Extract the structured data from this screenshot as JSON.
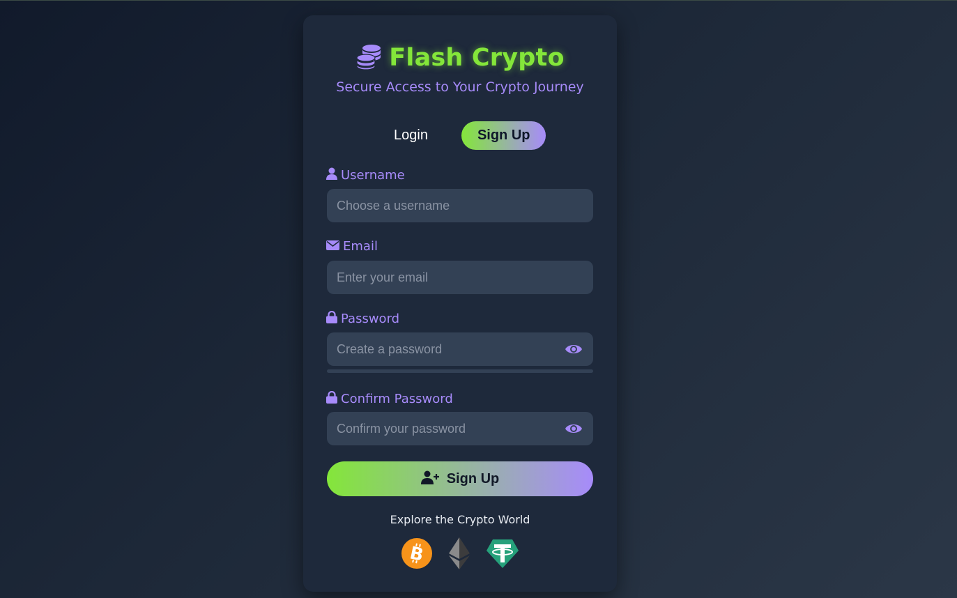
{
  "brand": {
    "title": "Flash Crypto",
    "subtitle": "Secure Access to Your Crypto Journey",
    "icon": "coins-icon"
  },
  "tabs": [
    {
      "label": "Login",
      "active": false
    },
    {
      "label": "Sign Up",
      "active": true
    }
  ],
  "form": {
    "username": {
      "label": "Username",
      "placeholder": "Choose a username",
      "value": "",
      "icon": "user-icon"
    },
    "email": {
      "label": "Email",
      "placeholder": "Enter your email",
      "value": "",
      "icon": "envelope-icon"
    },
    "password": {
      "label": "Password",
      "placeholder": "Create a password",
      "value": "",
      "icon": "lock-icon",
      "toggle_icon": "eye-icon"
    },
    "confirm_password": {
      "label": "Confirm Password",
      "placeholder": "Confirm your password",
      "value": "",
      "icon": "lock-icon",
      "toggle_icon": "eye-icon"
    },
    "password_strength": 0,
    "submit_label": "Sign Up",
    "submit_icon": "user-plus-icon"
  },
  "explore": {
    "label": "Explore the Crypto World",
    "coins": [
      {
        "name": "bitcoin-icon",
        "color": "#f7931a"
      },
      {
        "name": "ethereum-icon",
        "color": "#3c3c3d"
      },
      {
        "name": "tether-icon",
        "color": "#26a17b"
      }
    ]
  },
  "colors": {
    "accent_green": "#84e63a",
    "accent_purple": "#a78bfa",
    "card_bg": "#1e293b",
    "input_bg": "#334155"
  }
}
